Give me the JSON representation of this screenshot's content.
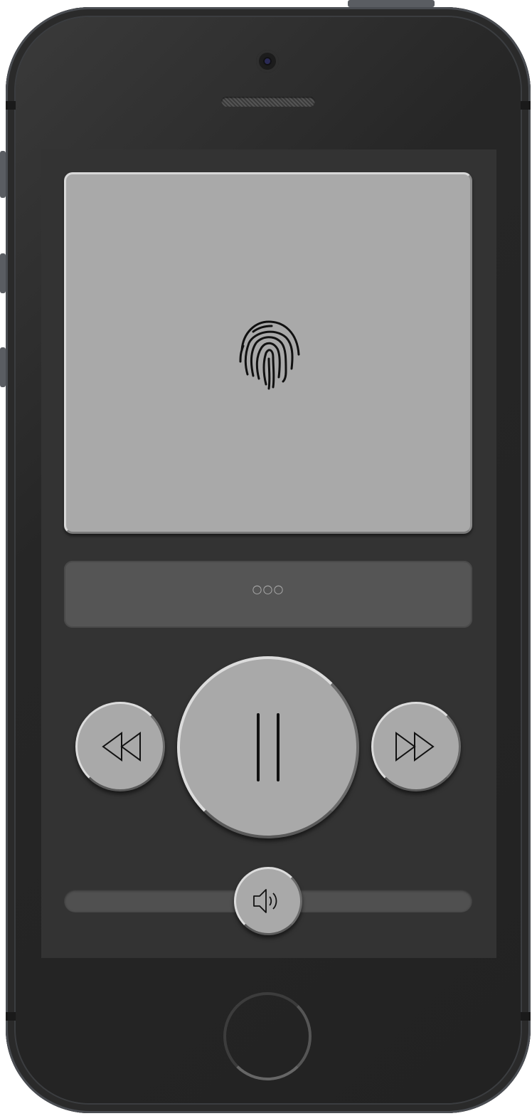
{
  "device": {
    "model": "iphone",
    "body_color": "#2c2c2c",
    "screen_color": "#333333"
  },
  "player": {
    "artwork_color": "#a9a9a9",
    "artwork_icon": "fingerprint-icon",
    "menu_label": "○○○",
    "controls": {
      "rewind_icon": "rewind-icon",
      "play_pause_icon": "pause-icon",
      "fast_forward_icon": "fast-forward-icon"
    },
    "volume": {
      "icon": "speaker-icon",
      "level": 0.5
    }
  }
}
